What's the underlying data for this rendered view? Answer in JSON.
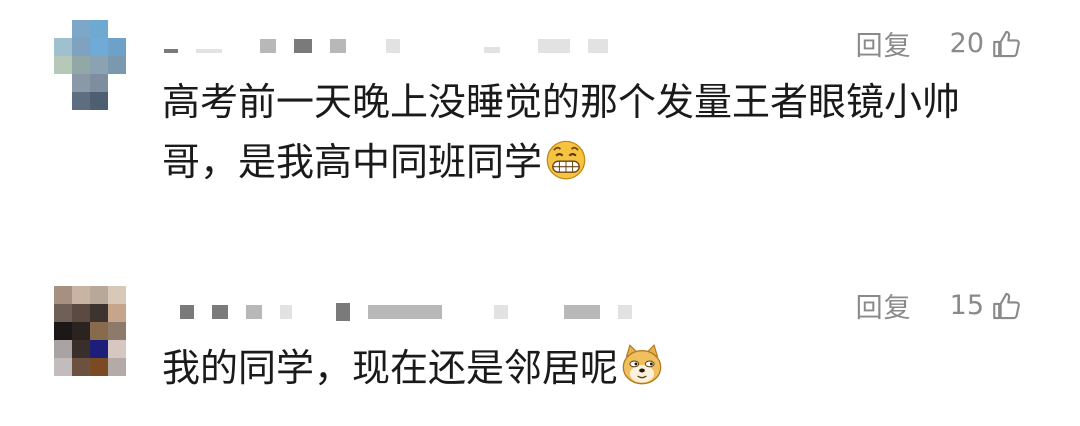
{
  "comments": [
    {
      "reply_label": "回复",
      "likes": "20",
      "text": "高考前一天晚上没睡觉的那个发量王者眼镜小帅哥，是我高中同班同学",
      "emoji": "grinning-emoji",
      "avatar_colors": [
        "#ffffff",
        "#7da7c9",
        "#6fa8d0",
        "#ffffff",
        "#9ec0cf",
        "#7ea2c0",
        "#70aad6",
        "#6ea1c7",
        "#b6c9b8",
        "#92a8a6",
        "#8aa3b3",
        "#7b99ae",
        "#ffffff",
        "#8a98a8",
        "#7f8e9f",
        "#ffffff",
        "#ffffff",
        "#5e6e80",
        "#4e5f72",
        "#ffffff"
      ]
    },
    {
      "reply_label": "回复",
      "likes": "15",
      "text": "我的同学，现在还是邻居呢",
      "emoji": "doge-emoji",
      "avatar_colors": [
        "#a59081",
        "#c9b3a2",
        "#b8a89a",
        "#d8c8b8",
        "#6e5f57",
        "#5a4a42",
        "#3d3430",
        "#c7a58b",
        "#1c1818",
        "#2a2320",
        "#8a6a4c",
        "#8e7a6a",
        "#a9a3a4",
        "#3a2e2a",
        "#1c1e7a",
        "#d6c8c0",
        "#c3bcbc",
        "#6c5040",
        "#7a4a22",
        "#b4aaa8"
      ]
    }
  ],
  "accent_colors": {
    "meta": "#8a8a8a",
    "text": "#1a1a1a"
  }
}
